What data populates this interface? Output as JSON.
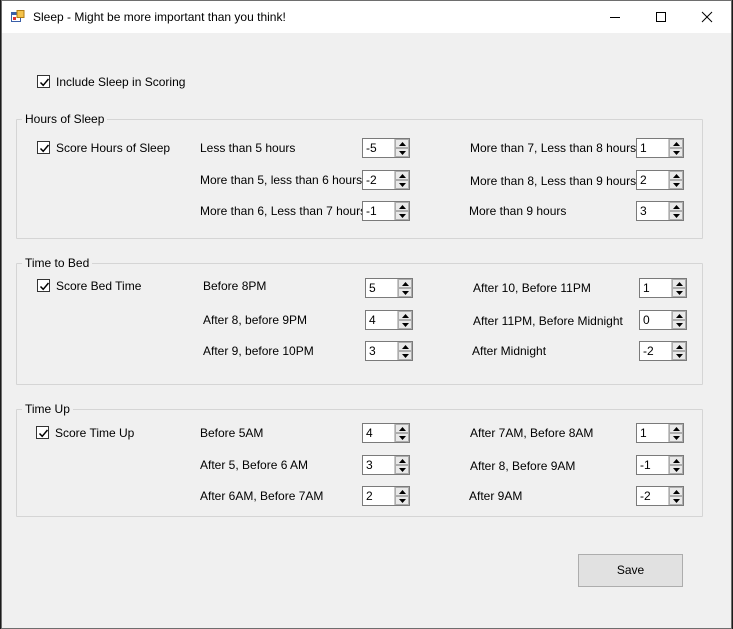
{
  "window": {
    "title": "Sleep - Might be more important than you think!"
  },
  "include": {
    "label": "Include Sleep in Scoring",
    "checked": true
  },
  "groups": [
    {
      "title": "Hours of Sleep",
      "checkbox_label": "Score Hours of Sleep",
      "rows": [
        {
          "label": "Less than 5 hours",
          "value": "-5"
        },
        {
          "label": "More than 5, less than 6 hours",
          "value": "-2"
        },
        {
          "label": "More than 6, Less than 7 hours",
          "value": "-1"
        },
        {
          "label": "More than 7, Less than 8 hours",
          "value": "1"
        },
        {
          "label": "More than 8, Less than 9 hours",
          "value": "2"
        },
        {
          "label": "More than 9 hours",
          "value": "3"
        }
      ]
    },
    {
      "title": "Time to Bed",
      "checkbox_label": "Score Bed Time",
      "rows": [
        {
          "label": "Before 8PM",
          "value": "5"
        },
        {
          "label": "After 8, before 9PM",
          "value": "4"
        },
        {
          "label": "After 9, before 10PM",
          "value": "3"
        },
        {
          "label": "After 10, Before 11PM",
          "value": "1"
        },
        {
          "label": "After 11PM, Before Midnight",
          "value": "0"
        },
        {
          "label": "After Midnight",
          "value": "-2"
        }
      ]
    },
    {
      "title": "Time Up",
      "checkbox_label": "Score Time Up",
      "rows": [
        {
          "label": "Before 5AM",
          "value": "4"
        },
        {
          "label": "After 5, Before 6 AM",
          "value": "3"
        },
        {
          "label": "After 6AM, Before 7AM",
          "value": "2"
        },
        {
          "label": "After 7AM, Before 8AM",
          "value": "1"
        },
        {
          "label": "After 8, Before 9AM",
          "value": "-1"
        },
        {
          "label": "After 9AM",
          "value": "-2"
        }
      ]
    }
  ],
  "save_label": "Save"
}
